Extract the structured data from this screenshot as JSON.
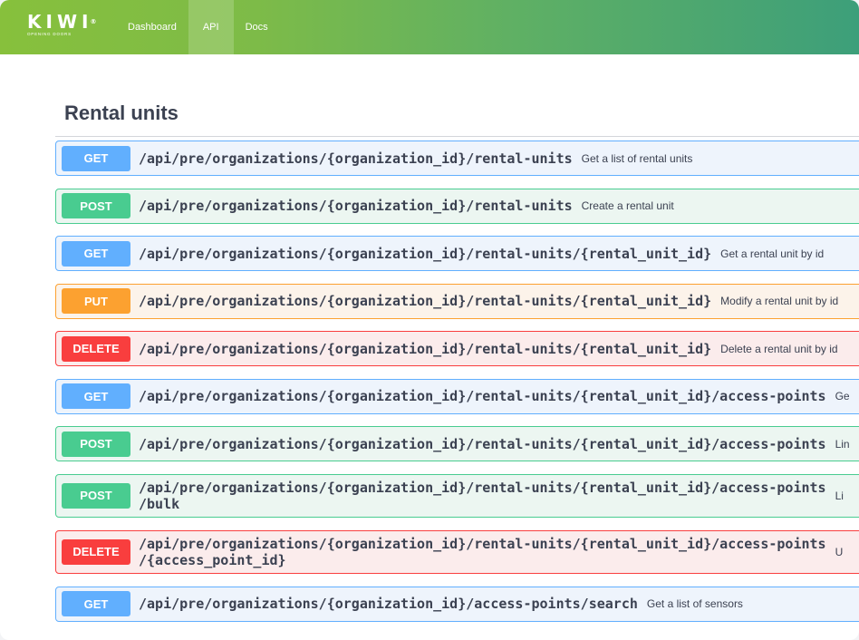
{
  "header": {
    "logo_text": "KIWI",
    "logo_mark": "®",
    "logo_tagline": "OPENING DOORS",
    "nav": [
      {
        "label": "Dashboard",
        "active": false
      },
      {
        "label": "API",
        "active": true
      },
      {
        "label": "Docs",
        "active": false
      }
    ]
  },
  "section": {
    "title": "Rental units"
  },
  "operations": [
    {
      "method": "GET",
      "path": "/api/pre/organizations/{organization_id}/rental-units",
      "summary": "Get a list of rental units"
    },
    {
      "method": "POST",
      "path": "/api/pre/organizations/{organization_id}/rental-units",
      "summary": "Create a rental unit"
    },
    {
      "method": "GET",
      "path": "/api/pre/organizations/{organization_id}/rental-units/{rental_unit_id}",
      "summary": "Get a rental unit by id"
    },
    {
      "method": "PUT",
      "path": "/api/pre/organizations/{organization_id}/rental-units/{rental_unit_id}",
      "summary": "Modify a rental unit by id"
    },
    {
      "method": "DELETE",
      "path": "/api/pre/organizations/{organization_id}/rental-units/{rental_unit_id}",
      "summary": "Delete a rental unit by id"
    },
    {
      "method": "GET",
      "path": "/api/pre/organizations/{organization_id}/rental-units/{rental_unit_id}/access-points",
      "summary": "Ge"
    },
    {
      "method": "POST",
      "path": "/api/pre/organizations/{organization_id}/rental-units/{rental_unit_id}/access-points",
      "summary": "Lin"
    },
    {
      "method": "POST",
      "path": "/api/pre/organizations/{organization_id}/rental-units/{rental_unit_id}/access-points\n/bulk",
      "summary": "Li"
    },
    {
      "method": "DELETE",
      "path": "/api/pre/organizations/{organization_id}/rental-units/{rental_unit_id}/access-points\n/{access_point_id}",
      "summary": "U"
    },
    {
      "method": "GET",
      "path": "/api/pre/organizations/{organization_id}/access-points/search",
      "summary": "Get a list of sensors"
    }
  ]
}
